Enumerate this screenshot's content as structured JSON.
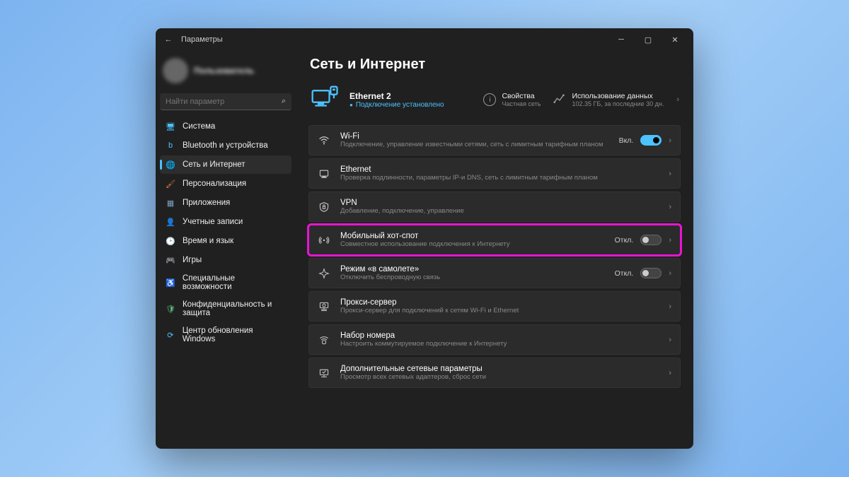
{
  "window": {
    "title": "Параметры"
  },
  "search": {
    "placeholder": "Найти параметр"
  },
  "nav": [
    {
      "label": "Система",
      "icon": "🖥",
      "color": "#4cc2ff"
    },
    {
      "label": "Bluetooth и устройства",
      "icon": "b",
      "color": "#4cc2ff"
    },
    {
      "label": "Сеть и Интернет",
      "icon": "🌐",
      "color": "#4cc2ff",
      "selected": true
    },
    {
      "label": "Персонализация",
      "icon": "🖌",
      "color": "#e08040"
    },
    {
      "label": "Приложения",
      "icon": "▦",
      "color": "#7aa0c0"
    },
    {
      "label": "Учетные записи",
      "icon": "👤",
      "color": "#60c080"
    },
    {
      "label": "Время и язык",
      "icon": "🕑",
      "color": "#60c0c0"
    },
    {
      "label": "Игры",
      "icon": "🎮",
      "color": "#50b080"
    },
    {
      "label": "Специальные возможности",
      "icon": "♿",
      "color": "#4cc2ff"
    },
    {
      "label": "Конфиденциальность и защита",
      "icon": "🛡",
      "color": "#60c080"
    },
    {
      "label": "Центр обновления Windows",
      "icon": "⟳",
      "color": "#4cc2ff"
    }
  ],
  "page": {
    "title": "Сеть и Интернет",
    "hero": {
      "name": "Ethernet 2",
      "status": "Подключение установлено",
      "props": {
        "label": "Свойства",
        "sub": "Частная сеть"
      },
      "usage": {
        "label": "Использование данных",
        "sub": "102.35 ГБ, за последние 30 дн."
      }
    },
    "cards": [
      {
        "icon": "wifi",
        "title": "Wi-Fi",
        "sub": "Подключение, управление известными сетями, сеть с лимитным тарифным планом",
        "toggle": "on",
        "toggle_label": "Вкл."
      },
      {
        "icon": "ethernet",
        "title": "Ethernet",
        "sub": "Проверка подлинности, параметры IP-и DNS, сеть с лимитным тарифным планом"
      },
      {
        "icon": "vpn",
        "title": "VPN",
        "sub": "Добавление, подключение, управление"
      },
      {
        "icon": "hotspot",
        "title": "Мобильный хот-спот",
        "sub": "Совместное использование подключения к Интернету",
        "toggle": "off",
        "toggle_label": "Откл.",
        "highlight": true
      },
      {
        "icon": "airplane",
        "title": "Режим «в самолете»",
        "sub": "Отключить беспроводную связь",
        "toggle": "off",
        "toggle_label": "Откл."
      },
      {
        "icon": "proxy",
        "title": "Прокси-сервер",
        "sub": "Прокси-сервер для подключений к сетям Wi-Fi и Ethernet"
      },
      {
        "icon": "dialup",
        "title": "Набор номера",
        "sub": "Настроить коммутируемое подключение к Интернету"
      },
      {
        "icon": "advanced",
        "title": "Дополнительные сетевые параметры",
        "sub": "Просмотр всех сетевых адаптеров, сброс сети"
      }
    ]
  }
}
